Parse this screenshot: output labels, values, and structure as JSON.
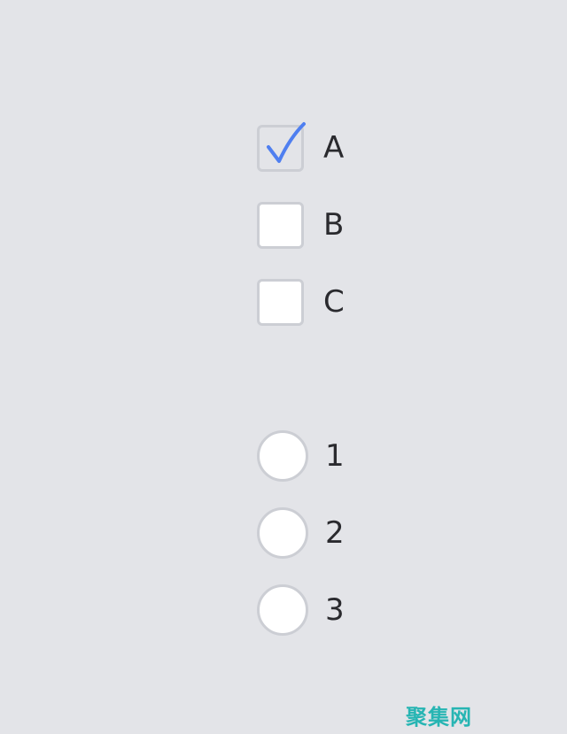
{
  "checkboxes": [
    {
      "label": "A",
      "checked": true
    },
    {
      "label": "B",
      "checked": false
    },
    {
      "label": "C",
      "checked": false
    }
  ],
  "radios": [
    {
      "label": "1",
      "selected": false
    },
    {
      "label": "2",
      "selected": false
    },
    {
      "label": "3",
      "selected": false
    }
  ],
  "watermark": "聚集网",
  "colors": {
    "background": "#e3e4e8",
    "check": "#4f7ff0",
    "border": "#ccced4",
    "watermark": "#27b5b3"
  }
}
